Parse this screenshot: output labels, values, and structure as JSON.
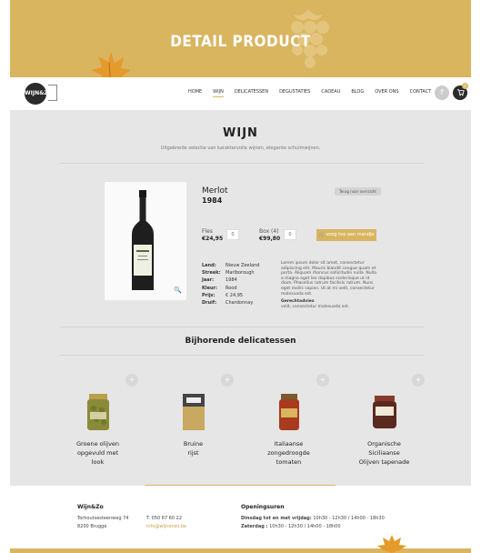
{
  "hero": {
    "title": "DETAIL PRODUCT"
  },
  "nav": {
    "logo": "WIJN&ZO",
    "items": [
      {
        "label": "HOME",
        "active": false
      },
      {
        "label": "WIJN",
        "active": true
      },
      {
        "label": "DELICATESSEN",
        "active": false
      },
      {
        "label": "DEGUSTATIES",
        "active": false
      },
      {
        "label": "CADEAU",
        "active": false
      },
      {
        "label": "BLOG",
        "active": false
      },
      {
        "label": "OVER ONS",
        "active": false
      },
      {
        "label": "CONTACT",
        "active": false
      }
    ],
    "facebook": "f",
    "cart_count": "0"
  },
  "section": {
    "title": "WIJN",
    "subtitle": "Uitgebreide selectie van karaktervolle wijnen, elegante schuimwijnen."
  },
  "product": {
    "name": "Merlot",
    "year": "1984",
    "back_label": "Terug naar overzicht",
    "options": [
      {
        "label": "Fles",
        "price": "€24,95",
        "qty": "0"
      },
      {
        "label": "Box (4)",
        "price": "€99,80",
        "qty": "0"
      }
    ],
    "add_button": "voeg toe aan mandje",
    "specs": [
      {
        "key": "Land:",
        "value": "Nieuw Zeeland"
      },
      {
        "key": "Streek:",
        "value": "Marlborough"
      },
      {
        "key": "Jaar:",
        "value": "1984"
      },
      {
        "key": "Kleur:",
        "value": "Rood"
      },
      {
        "key": "Prijs:",
        "value": "€ 24,95"
      },
      {
        "key": "Druif:",
        "value": "Chardonnay"
      }
    ],
    "description": "Lorem ipsum dolor sit amet, consectetur adipiscing elit. Mauris blandit congue quam et porta. Aliquam rhoncus sollicitudin nulla. Nulla a magna eget leo dapibus scelerisque ut id diam. Phasellus rutrum facilisis rutrum. Nunc eget mollis sapien. Ut at mi velit, consectetur malesuada est.",
    "pairing_title": "Gerechtadvies",
    "pairing_text": "velit, consectetur malesuada est."
  },
  "related": {
    "title": "Bijhorende delicatessen",
    "items": [
      {
        "name_lines": [
          "Groene olijven",
          "opgevuld met",
          "look"
        ]
      },
      {
        "name_lines": [
          "Bruine",
          "rijst"
        ]
      },
      {
        "name_lines": [
          "Italiaanse",
          "zongedroogde",
          "tomaten"
        ]
      },
      {
        "name_lines": [
          "Organische",
          "Siciliaanse",
          "Olijven tapenade"
        ]
      }
    ]
  },
  "footer": {
    "brand": "Wijn&Zo",
    "address1": "Torhoutsesteenweg 74",
    "address2": "8200 Brugge",
    "phone": "T. 050 67 60 22",
    "email": "info@wijnenzo.be",
    "hours_title": "Openingsuren",
    "hours1_label": "Dinsdag tot en met vrijdag:",
    "hours1_value": "10h30 - 12h30 / 14h00 - 18h30",
    "hours2_label": "Zaterdag :",
    "hours2_value": "10h30 - 12h30 / 14h00 - 18h00"
  },
  "colors": {
    "accent": "#d9b560",
    "background": "#e6e6e6",
    "dark": "#2b2b2b"
  }
}
